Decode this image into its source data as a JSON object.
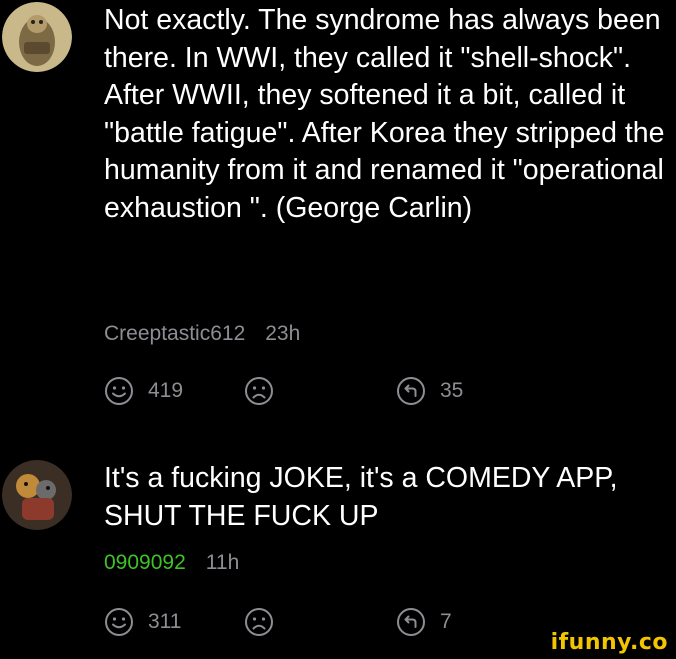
{
  "comments": [
    {
      "text": "Not exactly. The syndrome has always been there. In WWI, they called it \"shell-shock\". After WWII, they softened it a bit, called it \"battle fatigue\". After Korea they stripped the humanity from it and renamed it \"operational exhaustion \". (George Carlin)",
      "username": "Creeptastic612",
      "time": "23h",
      "smile_count": "419",
      "reply_count": "35"
    },
    {
      "text": "It's a fucking JOKE, it's a COMEDY APP, SHUT THE FUCK UP",
      "username": "0909092",
      "time": "11h",
      "smile_count": "311",
      "reply_count": "7"
    }
  ],
  "watermark": "ifunny.co",
  "colors": {
    "background": "#000000",
    "text": "#ffffff",
    "meta": "#8d8d93",
    "username_highlight": "#3fc128",
    "watermark": "#f2c500"
  },
  "icons": [
    "smile-icon",
    "sad-icon",
    "reply-icon"
  ]
}
